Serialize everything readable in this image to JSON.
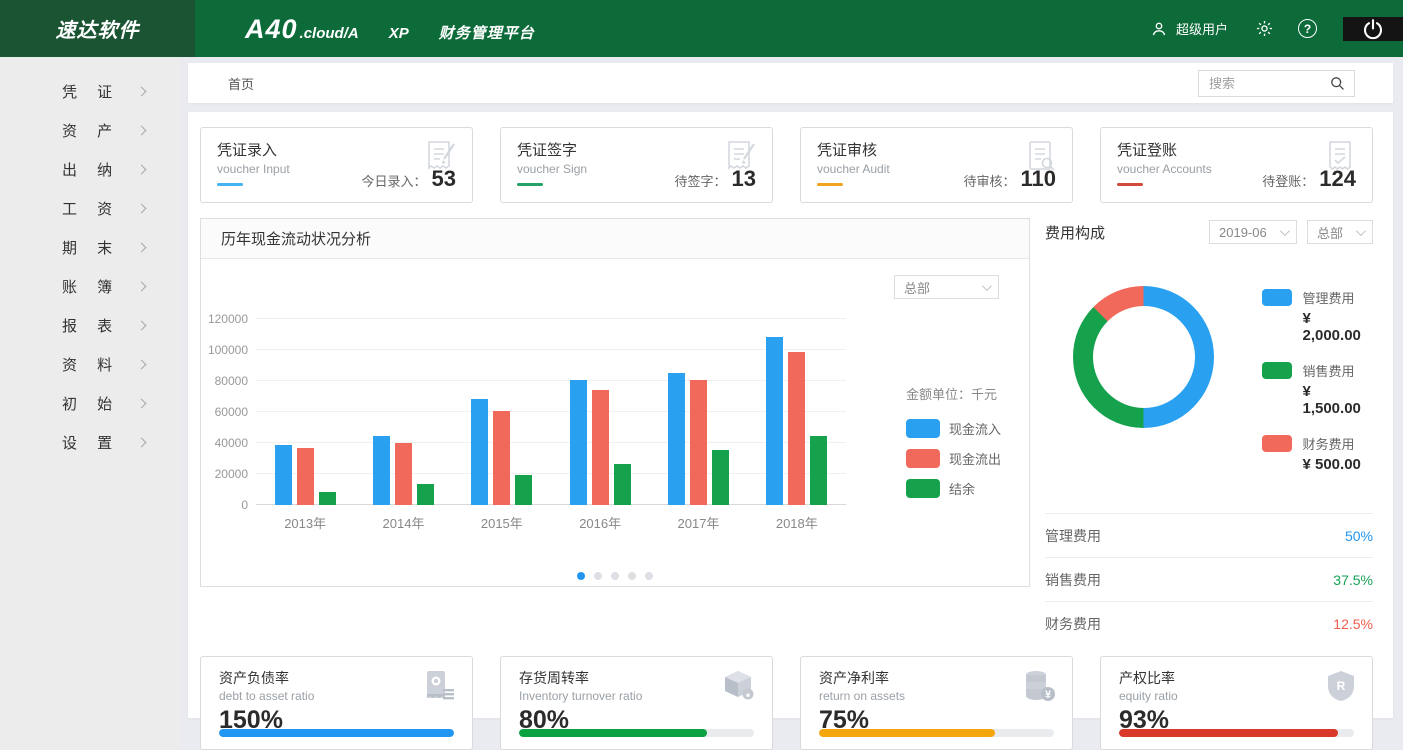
{
  "header": {
    "logo": "速达软件",
    "product": "A40",
    "product_suffix": ".cloud/A",
    "edition": "XP",
    "platform": "财务管理平台",
    "user": "超级用户",
    "colors": {
      "logo_bg": "#1b5433",
      "bar_bg": "#0d6b3a",
      "power_bg": "#141414"
    }
  },
  "sidebar": {
    "items": [
      {
        "label": "凭 证"
      },
      {
        "label": "资 产"
      },
      {
        "label": "出 纳"
      },
      {
        "label": "工 资"
      },
      {
        "label": "期 末"
      },
      {
        "label": "账 簿"
      },
      {
        "label": "报 表"
      },
      {
        "label": "资 料"
      },
      {
        "label": "初 始"
      },
      {
        "label": "设 置"
      }
    ]
  },
  "breadcrumb": {
    "home": "首页"
  },
  "search": {
    "placeholder": "搜索"
  },
  "voucher_cards": [
    {
      "title": "凭证录入",
      "subtitle": "voucher Input",
      "stat_label": "今日录入：",
      "value": "53",
      "accent": "#45b3ef"
    },
    {
      "title": "凭证签字",
      "subtitle": "voucher Sign",
      "stat_label": "待签字：",
      "value": "13",
      "accent": "#27a168"
    },
    {
      "title": "凭证审核",
      "subtitle": "voucher Audit",
      "stat_label": "待审核：",
      "value": "110",
      "accent": "#f0a31f"
    },
    {
      "title": "凭证登账",
      "subtitle": "voucher Accounts",
      "stat_label": "待登账：",
      "value": "124",
      "accent": "#d04a3a"
    }
  ],
  "cashflow_chart": {
    "title": "历年现金流动状况分析",
    "org_dropdown": "总部",
    "unit_label": "金额单位：千元",
    "chart_data": {
      "type": "bar",
      "categories": [
        "2013年",
        "2014年",
        "2015年",
        "2016年",
        "2017年",
        "2018年"
      ],
      "series": [
        {
          "name": "现金流入",
          "color": "#2aa0f0",
          "values": [
            39000,
            44500,
            68500,
            80500,
            85000,
            108500
          ]
        },
        {
          "name": "现金流出",
          "color": "#f0695a",
          "values": [
            36500,
            40000,
            60500,
            74000,
            80500,
            98500
          ]
        },
        {
          "name": "结余",
          "color": "#16a14c",
          "values": [
            8500,
            13500,
            19500,
            26500,
            35500,
            44500
          ]
        }
      ],
      "ylim": [
        0,
        120000
      ],
      "yticks": [
        0,
        20000,
        40000,
        60000,
        80000,
        100000,
        120000
      ],
      "grid": true,
      "legend_position": "right"
    },
    "pagination": {
      "count": 5,
      "active_index": 0
    }
  },
  "expense_panel": {
    "title": "费用构成",
    "period_dropdown": "2019-06",
    "org_dropdown": "总部",
    "chart_data": {
      "type": "pie",
      "categories": [
        "管理费用",
        "销售费用",
        "财务费用"
      ],
      "values": [
        2000,
        1500,
        500
      ],
      "percents": [
        50,
        37.5,
        12.5
      ],
      "colors": [
        "#2aa0f0",
        "#16a14c",
        "#f0695a"
      ]
    },
    "legend": [
      {
        "name": "管理费用",
        "value": "¥ 2,000.00",
        "color": "#2aa0f0"
      },
      {
        "name": "销售费用",
        "value": "¥ 1,500.00",
        "color": "#16a14c"
      },
      {
        "name": "财务费用",
        "value": "¥ 500.00",
        "color": "#f0695a"
      }
    ],
    "rows": [
      {
        "name": "管理费用",
        "pct": "50%",
        "color": "#2196f3"
      },
      {
        "name": "销售费用",
        "pct": "37.5%",
        "color": "#18a058"
      },
      {
        "name": "财务费用",
        "pct": "12.5%",
        "color": "#ef5d4e"
      }
    ]
  },
  "ratio_cards": [
    {
      "title": "资产负债率",
      "subtitle": "debt to asset ratio",
      "value": "150%",
      "fill_pct": 100,
      "color": "#2196f3"
    },
    {
      "title": "存货周转率",
      "subtitle": "Inventory turnover ratio",
      "value": "80%",
      "fill_pct": 80,
      "color": "#0fa050",
      "color_fix": "#0ca242"
    },
    {
      "title": "资产净利率",
      "subtitle": "return on assets",
      "value": "75%",
      "fill_pct": 75,
      "color": "#f5a60d"
    },
    {
      "title": "产权比率",
      "subtitle": "equity ratio",
      "value": "93%",
      "fill_pct": 93,
      "color": "#da382a"
    }
  ]
}
